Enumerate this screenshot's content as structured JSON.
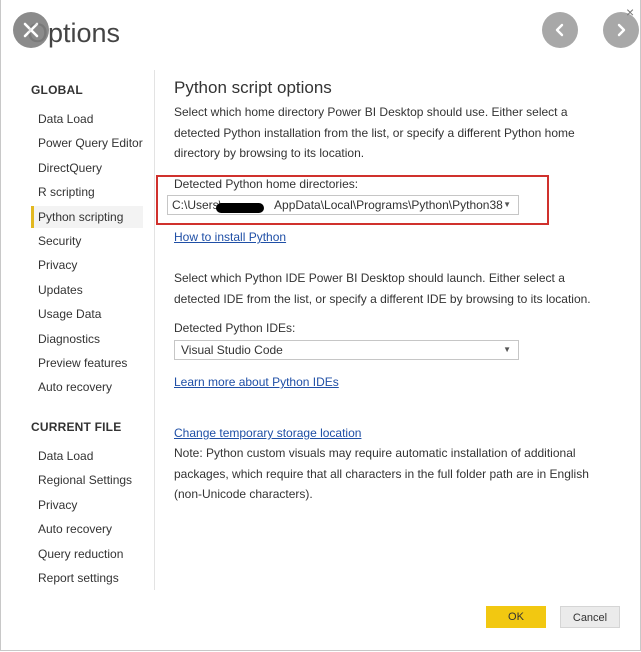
{
  "dialog": {
    "title": "Options",
    "close_icon": "close-icon",
    "prev_icon": "chevron-left-icon",
    "next_icon": "chevron-right-icon",
    "corner_close": "×"
  },
  "sidebar": {
    "global_heading": "GLOBAL",
    "global_items": [
      {
        "label": "Data Load"
      },
      {
        "label": "Power Query Editor"
      },
      {
        "label": "DirectQuery"
      },
      {
        "label": "R scripting"
      },
      {
        "label": "Python scripting",
        "selected": true
      },
      {
        "label": "Security"
      },
      {
        "label": "Privacy"
      },
      {
        "label": "Updates"
      },
      {
        "label": "Usage Data"
      },
      {
        "label": "Diagnostics"
      },
      {
        "label": "Preview features"
      },
      {
        "label": "Auto recovery"
      }
    ],
    "current_heading": "CURRENT FILE",
    "current_items": [
      {
        "label": "Data Load"
      },
      {
        "label": "Regional Settings"
      },
      {
        "label": "Privacy"
      },
      {
        "label": "Auto recovery"
      },
      {
        "label": "Query reduction"
      },
      {
        "label": "Report settings"
      }
    ]
  },
  "main": {
    "heading": "Python script options",
    "intro_lines": [
      "Select which home directory Power BI Desktop should use. Either select a",
      "detected Python installation from the list, or specify a different Python home",
      "directory by browsing to its location."
    ],
    "home_label": "Detected Python home directories:",
    "home_value_prefix": "C:\\Users\\",
    "home_value_suffix": "AppData\\Local\\Programs\\Python\\Python38",
    "install_link": "How to install Python",
    "ide_intro_lines": [
      "Select which Python IDE Power BI Desktop should launch. Either select a",
      "detected IDE from the list, or specify a different IDE by browsing to its location."
    ],
    "ide_label": "Detected Python IDEs:",
    "ide_value": "Visual Studio Code",
    "ide_link": "Learn more about Python IDEs",
    "storage_link": "Change temporary storage location",
    "note_lines": [
      "Note: Python custom visuals may require automatic installation of additional",
      "packages, which require that all characters in the full folder path are in English",
      "(non-Unicode characters)."
    ]
  },
  "buttons": {
    "ok": "OK",
    "cancel": "Cancel"
  },
  "colors": {
    "accent": "#f2c811",
    "highlight": "#d0312d",
    "link": "#1f4fa6"
  }
}
